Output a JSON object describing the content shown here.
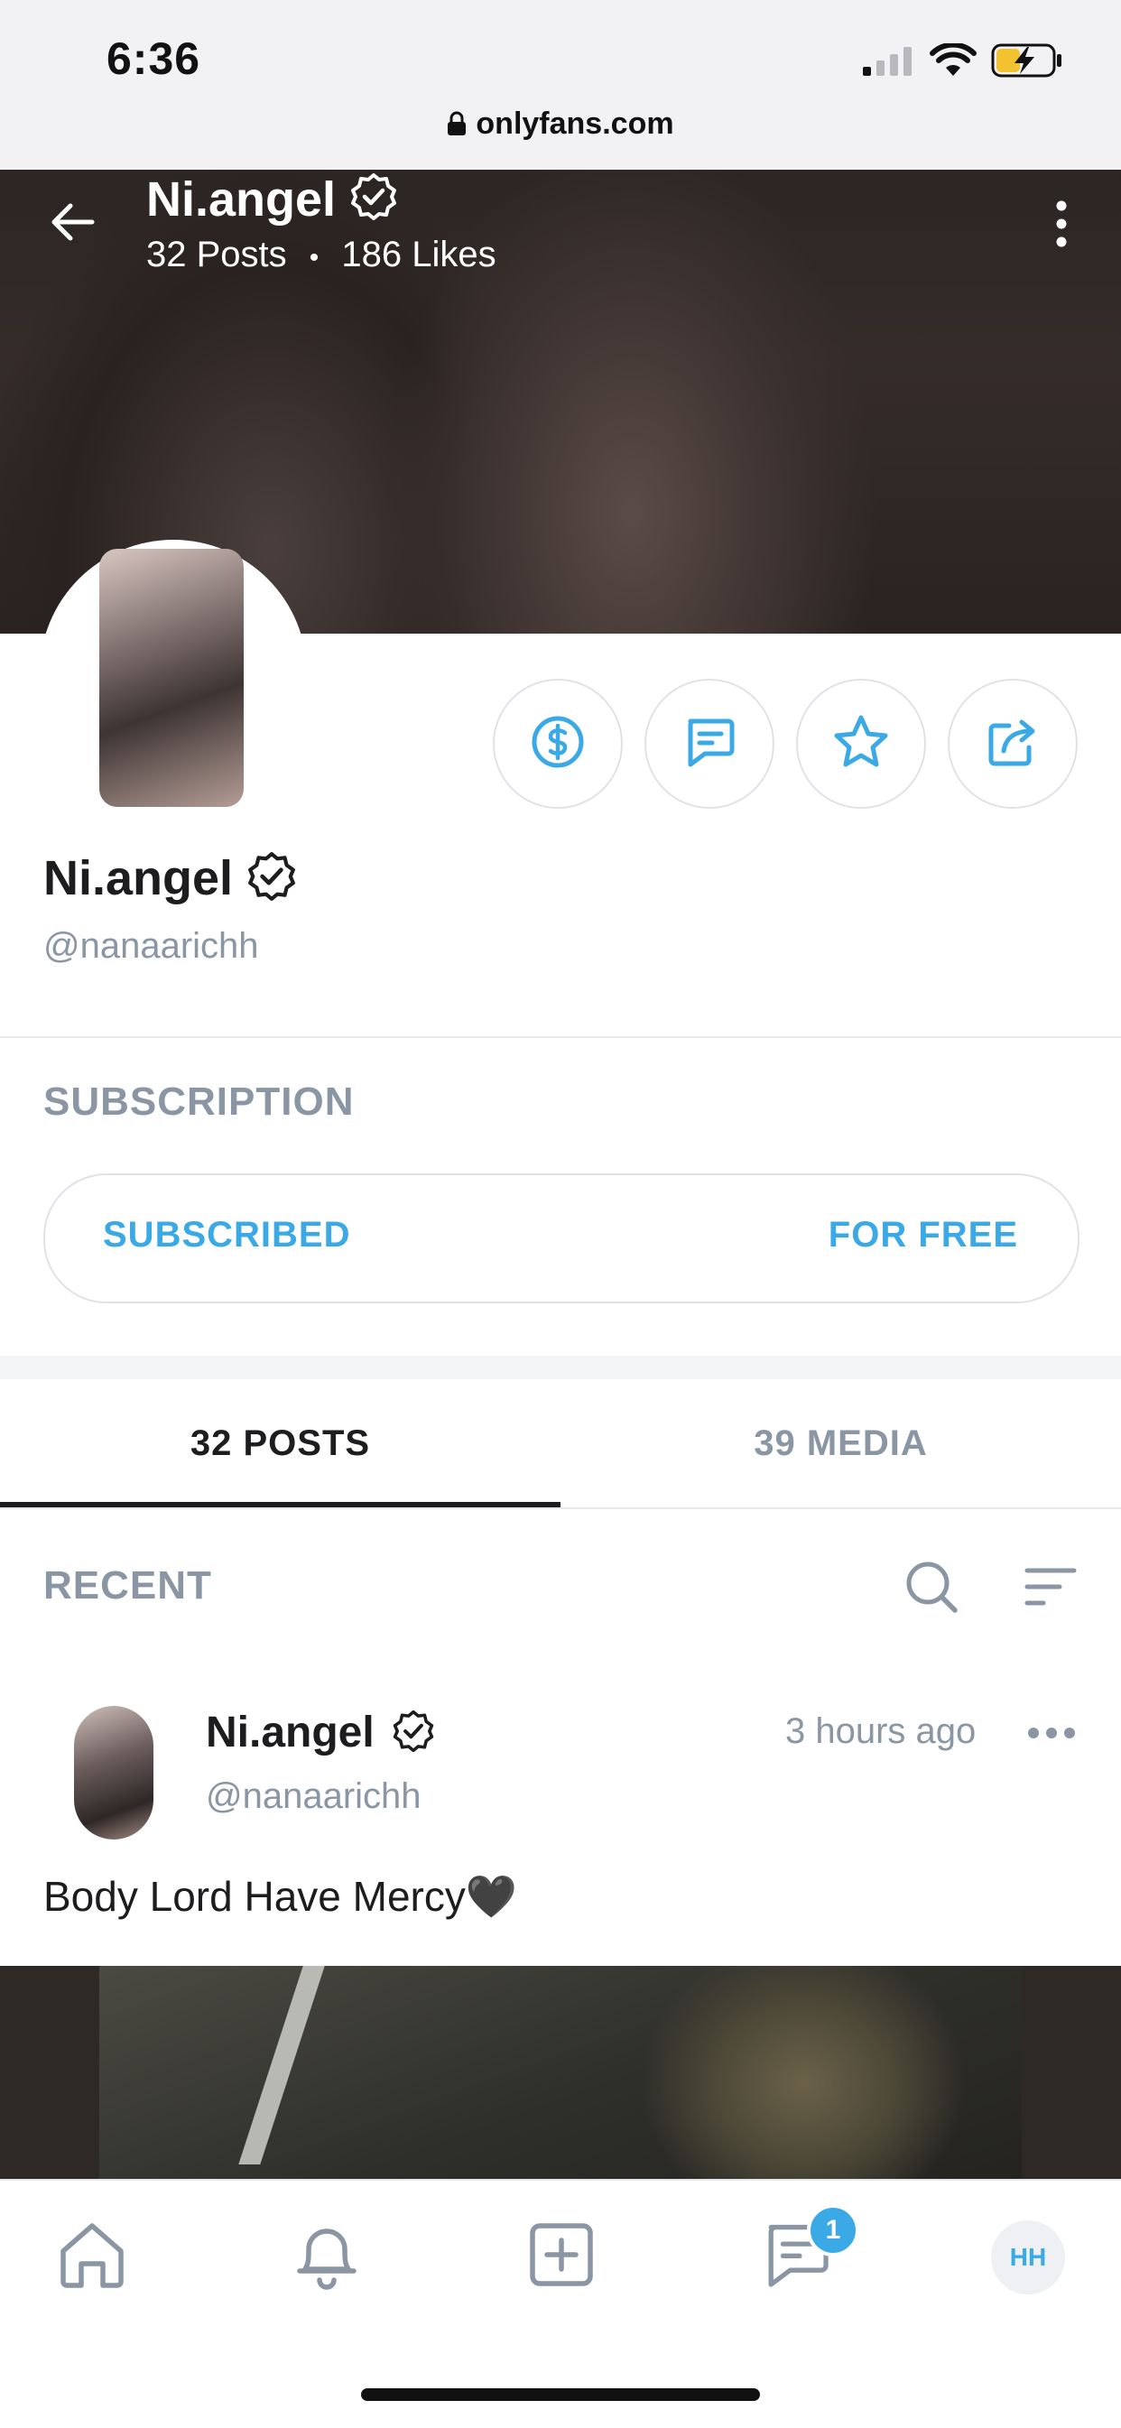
{
  "status_bar": {
    "time": "6:36",
    "url": "onlyfans.com"
  },
  "header": {
    "name": "Ni.angel",
    "posts": "32 Posts",
    "separator": "•",
    "likes": "186 Likes"
  },
  "profile": {
    "name": "Ni.angel",
    "handle": "@nanaarichh"
  },
  "subscription": {
    "title": "SUBSCRIPTION",
    "status": "SUBSCRIBED",
    "price": "FOR FREE"
  },
  "tabs": [
    {
      "label": "32 POSTS",
      "active": true
    },
    {
      "label": "39 MEDIA",
      "active": false
    }
  ],
  "feed": {
    "section_title": "RECENT"
  },
  "post": {
    "name": "Ni.angel",
    "handle": "@nanaarichh",
    "time": "3 hours ago",
    "text": "Body Lord Have Mercy🖤"
  },
  "bottom_nav": {
    "messages_badge": "1",
    "user_initials": "HH"
  },
  "colors": {
    "accent": "#3aa9e6",
    "muted": "#8a96a3",
    "text": "#1d1d1f"
  }
}
